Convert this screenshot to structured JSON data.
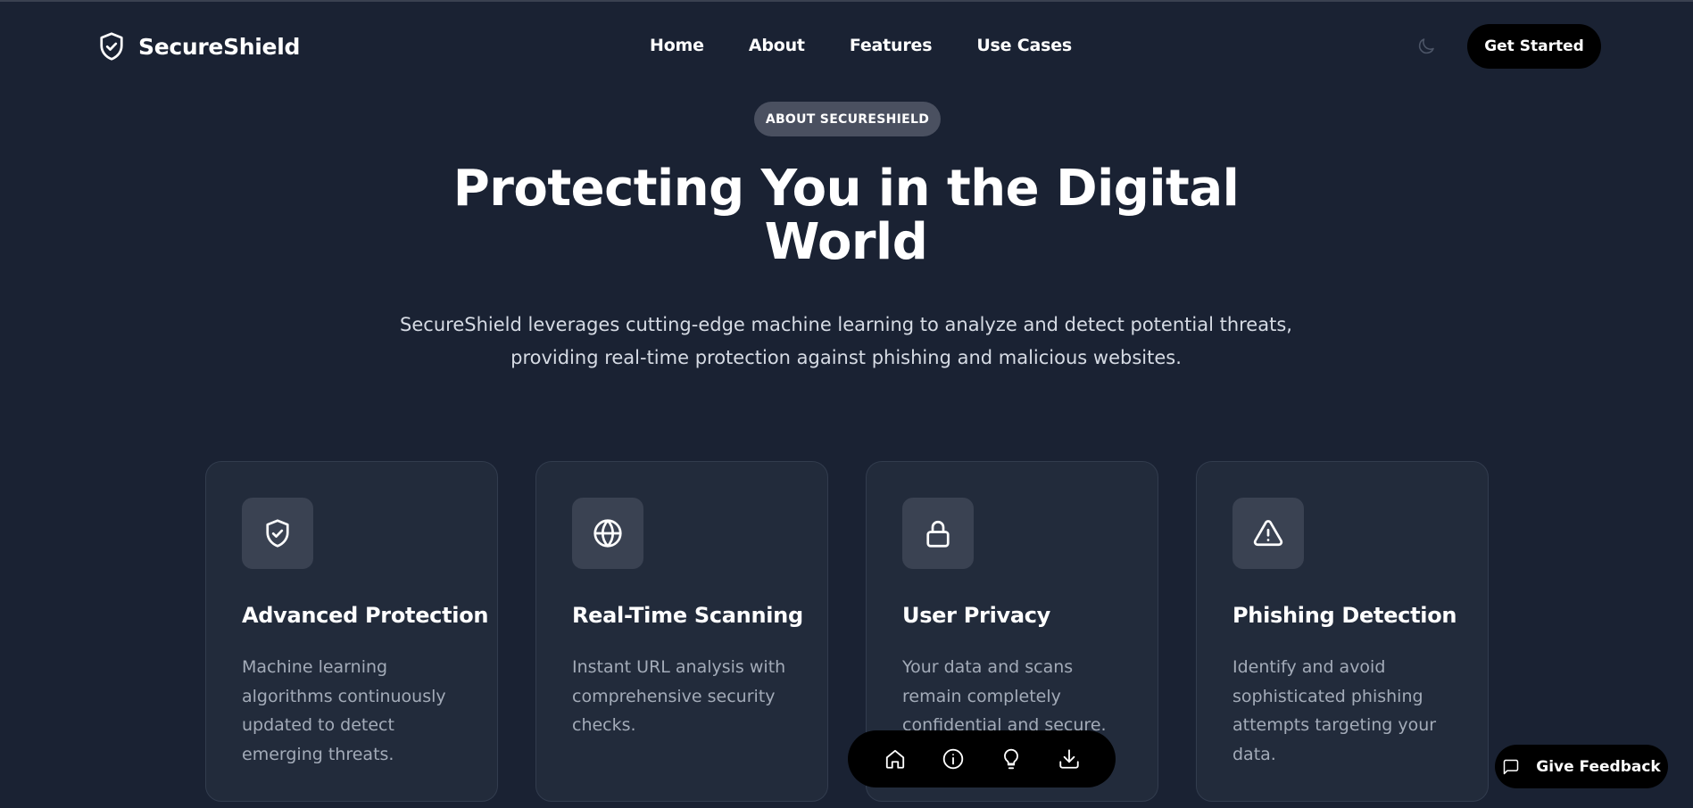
{
  "header": {
    "brand": "SecureShield",
    "nav": [
      "Home",
      "About",
      "Features",
      "Use Cases"
    ],
    "cta_label": "Get Started",
    "theme_icon": "moon-icon"
  },
  "hero": {
    "badge": "ABOUT SECURESHIELD",
    "title": "Protecting You in the Digital World",
    "subtitle": "SecureShield leverages cutting-edge machine learning to analyze and detect potential threats, providing real-time protection against phishing and malicious websites."
  },
  "features": [
    {
      "icon": "shield-check-icon",
      "title": "Advanced Protection",
      "description": "Machine learning algorithms continuously updated to detect emerging threats."
    },
    {
      "icon": "globe-icon",
      "title": "Real-Time Scanning",
      "description": "Instant URL analysis with comprehensive security checks."
    },
    {
      "icon": "lock-icon",
      "title": "User Privacy",
      "description": "Your data and scans remain completely confidential and secure."
    },
    {
      "icon": "alert-triangle-icon",
      "title": "Phishing Detection",
      "description": "Identify and avoid sophisticated phishing attempts targeting your data."
    }
  ],
  "dock": {
    "items": [
      "home-icon",
      "info-icon",
      "lightbulb-icon",
      "download-icon"
    ]
  },
  "feedback": {
    "label": "Give Feedback",
    "icon": "message-square-icon"
  },
  "colors": {
    "background": "#1a2233",
    "card": "#222b3b",
    "icon_tile": "#3a4252",
    "badge": "#4a5060",
    "button": "#000000",
    "muted_text": "#a3abb8"
  }
}
